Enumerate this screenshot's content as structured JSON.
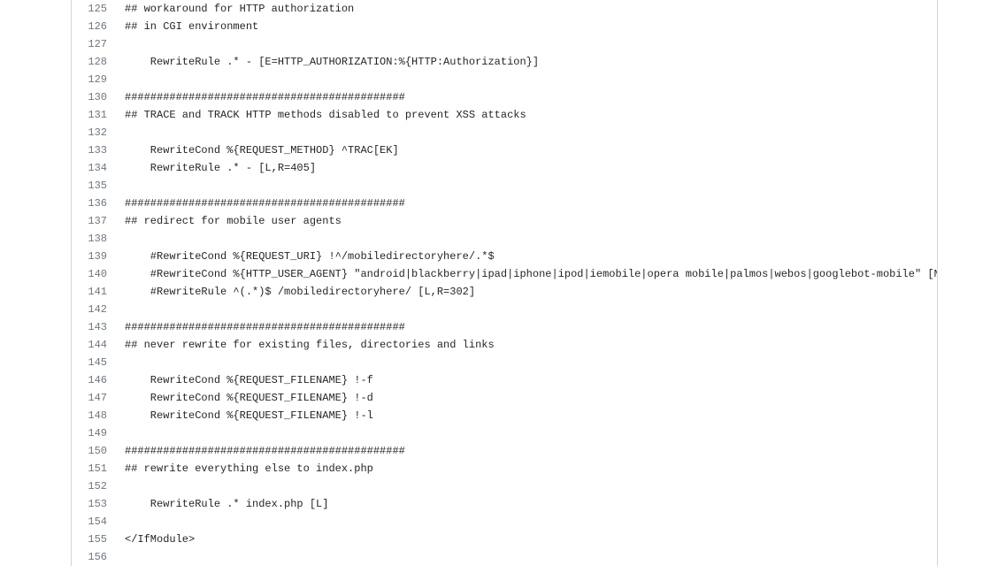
{
  "lines": [
    {
      "num": 125,
      "text": "## workaround for HTTP authorization"
    },
    {
      "num": 126,
      "text": "## in CGI environment"
    },
    {
      "num": 127,
      "text": ""
    },
    {
      "num": 128,
      "text": "    RewriteRule .* - [E=HTTP_AUTHORIZATION:%{HTTP:Authorization}]"
    },
    {
      "num": 129,
      "text": ""
    },
    {
      "num": 130,
      "text": "############################################"
    },
    {
      "num": 131,
      "text": "## TRACE and TRACK HTTP methods disabled to prevent XSS attacks"
    },
    {
      "num": 132,
      "text": ""
    },
    {
      "num": 133,
      "text": "    RewriteCond %{REQUEST_METHOD} ^TRAC[EK]"
    },
    {
      "num": 134,
      "text": "    RewriteRule .* - [L,R=405]"
    },
    {
      "num": 135,
      "text": ""
    },
    {
      "num": 136,
      "text": "############################################"
    },
    {
      "num": 137,
      "text": "## redirect for mobile user agents"
    },
    {
      "num": 138,
      "text": ""
    },
    {
      "num": 139,
      "text": "    #RewriteCond %{REQUEST_URI} !^/mobiledirectoryhere/.*$"
    },
    {
      "num": 140,
      "text": "    #RewriteCond %{HTTP_USER_AGENT} \"android|blackberry|ipad|iphone|ipod|iemobile|opera mobile|palmos|webos|googlebot-mobile\" [NC]"
    },
    {
      "num": 141,
      "text": "    #RewriteRule ^(.*)$ /mobiledirectoryhere/ [L,R=302]"
    },
    {
      "num": 142,
      "text": ""
    },
    {
      "num": 143,
      "text": "############################################"
    },
    {
      "num": 144,
      "text": "## never rewrite for existing files, directories and links"
    },
    {
      "num": 145,
      "text": ""
    },
    {
      "num": 146,
      "text": "    RewriteCond %{REQUEST_FILENAME} !-f"
    },
    {
      "num": 147,
      "text": "    RewriteCond %{REQUEST_FILENAME} !-d"
    },
    {
      "num": 148,
      "text": "    RewriteCond %{REQUEST_FILENAME} !-l"
    },
    {
      "num": 149,
      "text": ""
    },
    {
      "num": 150,
      "text": "############################################"
    },
    {
      "num": 151,
      "text": "## rewrite everything else to index.php"
    },
    {
      "num": 152,
      "text": ""
    },
    {
      "num": 153,
      "text": "    RewriteRule .* index.php [L]"
    },
    {
      "num": 154,
      "text": ""
    },
    {
      "num": 155,
      "text": "</IfModule>"
    },
    {
      "num": 156,
      "text": ""
    }
  ]
}
